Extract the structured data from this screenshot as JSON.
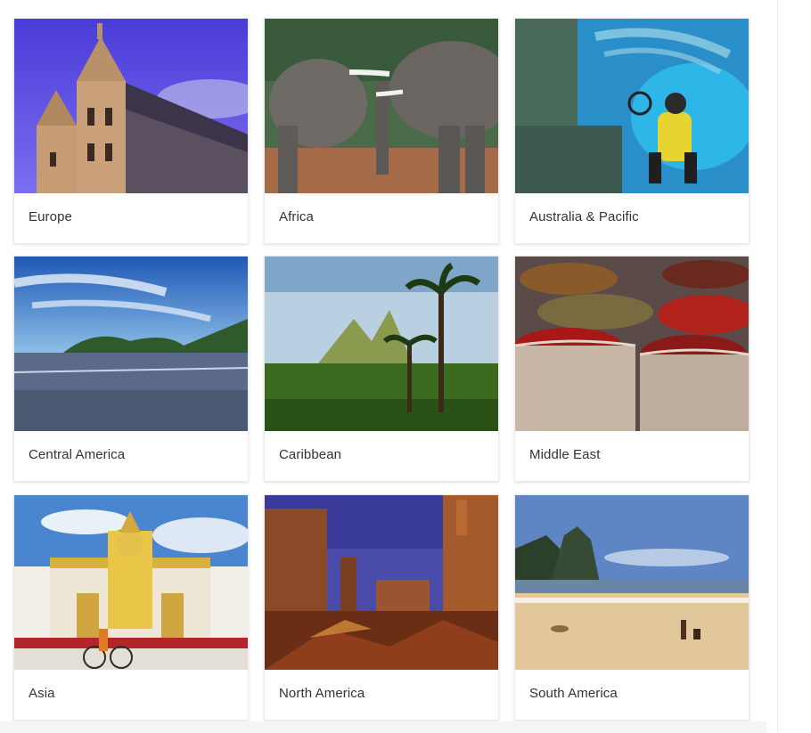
{
  "destinations": [
    {
      "label": "Europe",
      "icon": "europe-cathedral-image"
    },
    {
      "label": "Africa",
      "icon": "africa-elephants-image"
    },
    {
      "label": "Australia & Pacific",
      "icon": "australia-diver-image"
    },
    {
      "label": "Central America",
      "icon": "central-america-beach-image"
    },
    {
      "label": "Caribbean",
      "icon": "caribbean-palms-image"
    },
    {
      "label": "Middle East",
      "icon": "middle-east-spices-image"
    },
    {
      "label": "Asia",
      "icon": "asia-temple-image"
    },
    {
      "label": "North America",
      "icon": "north-america-canyon-image"
    },
    {
      "label": "South America",
      "icon": "south-america-beach-image"
    }
  ]
}
